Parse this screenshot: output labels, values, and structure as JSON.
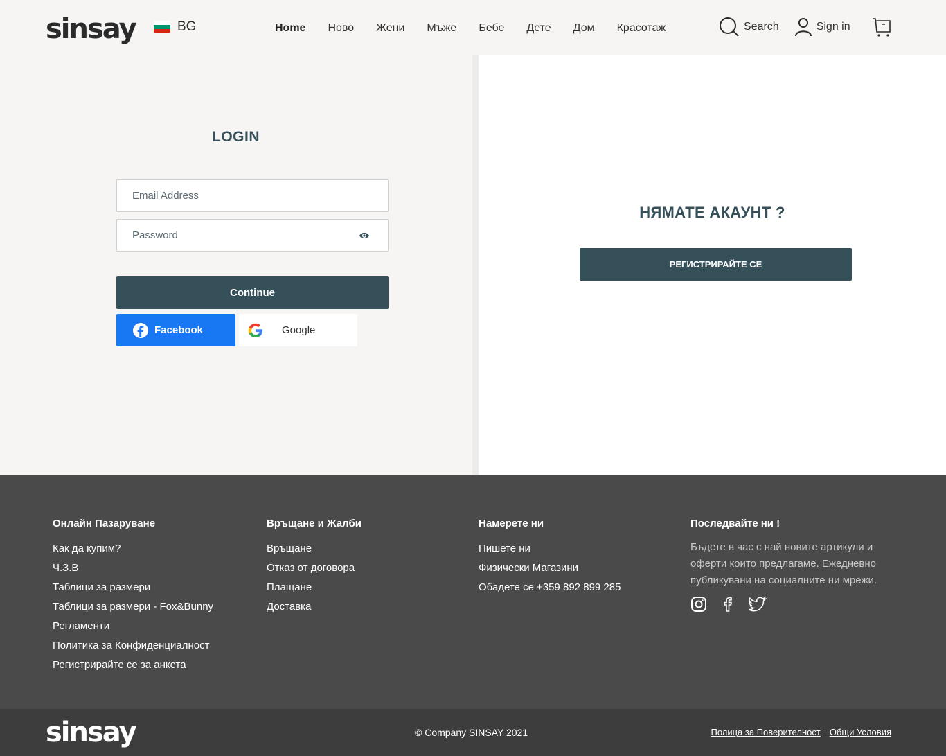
{
  "header": {
    "logo": "sinsay",
    "language": "BG",
    "nav": [
      "Home",
      "Ново",
      "Жени",
      "Мъже",
      "Бебе",
      "Дете",
      "Дом",
      "Красотаж"
    ],
    "search_label": "Search",
    "signin_label": "Sign in"
  },
  "login": {
    "title": "LOGIN",
    "email_placeholder": "Email Address",
    "password_placeholder": "Password",
    "continue_label": "Continue",
    "facebook_label": "Facebook",
    "google_label": "Google"
  },
  "register": {
    "title": "НЯМАТЕ АКАУНТ ?",
    "button_label": "РЕГИСТРИРАЙТЕ СЕ"
  },
  "footer": {
    "col1": {
      "title": "Онлайн Пазаруване",
      "links": [
        "Как да купим?",
        "Ч.З.В",
        "Таблици за размери",
        "Таблици за размери - Fox&Bunny",
        "Регламенти",
        "Политика за Конфиденциалност",
        "Регистрирайте се за анкета"
      ]
    },
    "col2": {
      "title": "Връщане и Жалби",
      "links": [
        "Връщане",
        "Отказ от договора",
        "Плащане",
        "Доставка"
      ]
    },
    "col3": {
      "title": "Намерете ни",
      "links": [
        "Пишете ни",
        "Физически Магазини",
        "Обадете се +359 892 899 285"
      ]
    },
    "col4": {
      "title": "Последвайте ни !",
      "text": "Бъдете в час с най новите артикули и оферти които предлагаме. Ежедневно публикувани на социалните ни мрежи."
    }
  },
  "bottom": {
    "logo": "sinsay",
    "copyright": "© Company SINSAY 2021",
    "privacy_label": "Полица за Поверителност",
    "terms_label": "Общи Условия"
  },
  "colors": {
    "primary": "#36505a",
    "facebook": "#1877f2",
    "footer_bg": "#4a4a4a",
    "bottom_bg": "#3d3d3d"
  }
}
